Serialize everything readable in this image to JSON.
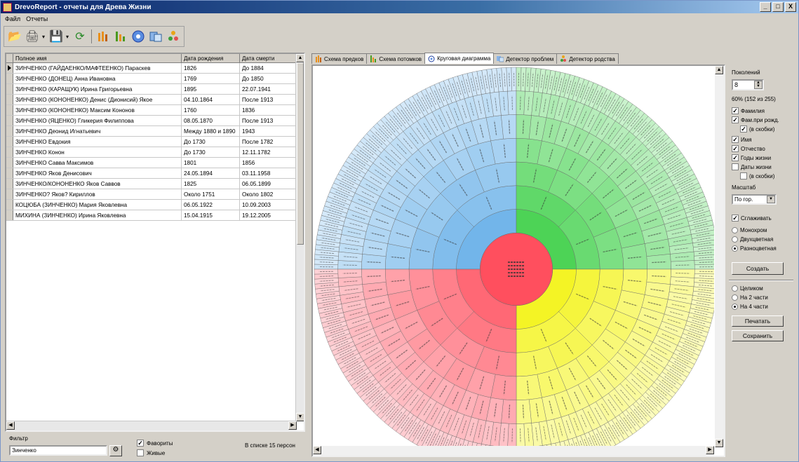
{
  "window": {
    "title": "DrevoReport - отчеты для Древа Жизни",
    "min": "_",
    "max": "□",
    "close": "X"
  },
  "menu": [
    "Файл",
    "Отчеты"
  ],
  "toolbar": {
    "icons": [
      "open-icon",
      "print-icon",
      "save-icon",
      "refresh-icon",
      "ancestors-icon",
      "descendants-icon",
      "circle-chart-icon",
      "problems-icon",
      "relations-icon"
    ]
  },
  "grid": {
    "columns": [
      "Полное имя",
      "Дата рождения",
      "Дата смерти"
    ],
    "rows": [
      [
        "ЗИНЧЕНКО (ГАЙДАЕНКО/МАФТЕЕНКО) Параскев",
        "1826",
        "До 1884"
      ],
      [
        "ЗИНЧЕНКО (ДОНЕЦ) Анна Ивановна",
        "1769",
        "До 1850"
      ],
      [
        "ЗИНЧЕНКО (КАРАЩУК) Ирина Григорьевна",
        "1895",
        "22.07.1941"
      ],
      [
        "ЗИНЧЕНКО (КОНОНЕНКО) Денис (Дионисий) Якое",
        "04.10.1864",
        "После 1913"
      ],
      [
        "ЗИНЧЕНКО (КОНОНЕНКО) Максим Кононов",
        "1760",
        "1836"
      ],
      [
        "ЗИНЧЕНКО (ЯЦЕНКО) Гликерия Филиппова",
        "08.05.1870",
        "После 1913"
      ],
      [
        "ЗИНЧЕНКО Деонид Игнатьевич",
        "Между 1880 и 1890",
        "1943"
      ],
      [
        "ЗИНЧЕНКО Евдокия",
        "До 1730",
        "После 1782"
      ],
      [
        "ЗИНЧЕНКО Конон",
        "До 1730",
        "12.11.1782"
      ],
      [
        "ЗИНЧЕНКО Савва Максимов",
        "1801",
        "1856"
      ],
      [
        "ЗИНЧЕНКО Яков Денисович",
        "24.05.1894",
        "03.11.1958"
      ],
      [
        "ЗИНЧЕНКО/КОНОНЕНКО Яков Саввов",
        "1825",
        "06.05.1899"
      ],
      [
        "ЗИНЧЕНКО? Яков? Кириллов",
        "Около 1751",
        "Около 1802"
      ],
      [
        "КОЦЮБА (ЗИНЧЕНКО) Мария Яковлевна",
        "06.05.1922",
        "10.09.2003"
      ],
      [
        "МИХИНА (ЗИНЧЕНКО) Ирина Яковлевна",
        "15.04.1915",
        "19.12.2005"
      ]
    ]
  },
  "filter": {
    "label": "Фильтр",
    "value": "Зинченко",
    "favorites": "Фавориты",
    "alive": "Живые",
    "count": "В списке 15 персон"
  },
  "tabs": [
    "Схема предков",
    "Схема потомков",
    "Круговая диаграмма",
    "Детектор проблем",
    "Детектор родства"
  ],
  "right": {
    "generations_label": "Поколений",
    "generations_value": "8",
    "stat": "60% (152 из 255)",
    "opts": [
      "Фамилия",
      "Фам.при рожд.",
      "(в скобки)",
      "Имя",
      "Отчество",
      "Годы жизни",
      "Даты жизни",
      "(в скобки)"
    ],
    "scale_label": "Масштаб",
    "scale_value": "По гор.",
    "smooth": "Сглаживать",
    "color_modes": [
      "Монохром",
      "Двухцветная",
      "Разноцветная"
    ],
    "create": "Создать",
    "parts": [
      "Целиком",
      "На 2 части",
      "На 4 части"
    ],
    "print": "Печатать",
    "save": "Сохранить"
  },
  "chart": {
    "generations": 8,
    "quadrant_colors": [
      "#5aa9e6",
      "#2fcc3a",
      "#f2f200",
      "#ff4f5e"
    ]
  }
}
